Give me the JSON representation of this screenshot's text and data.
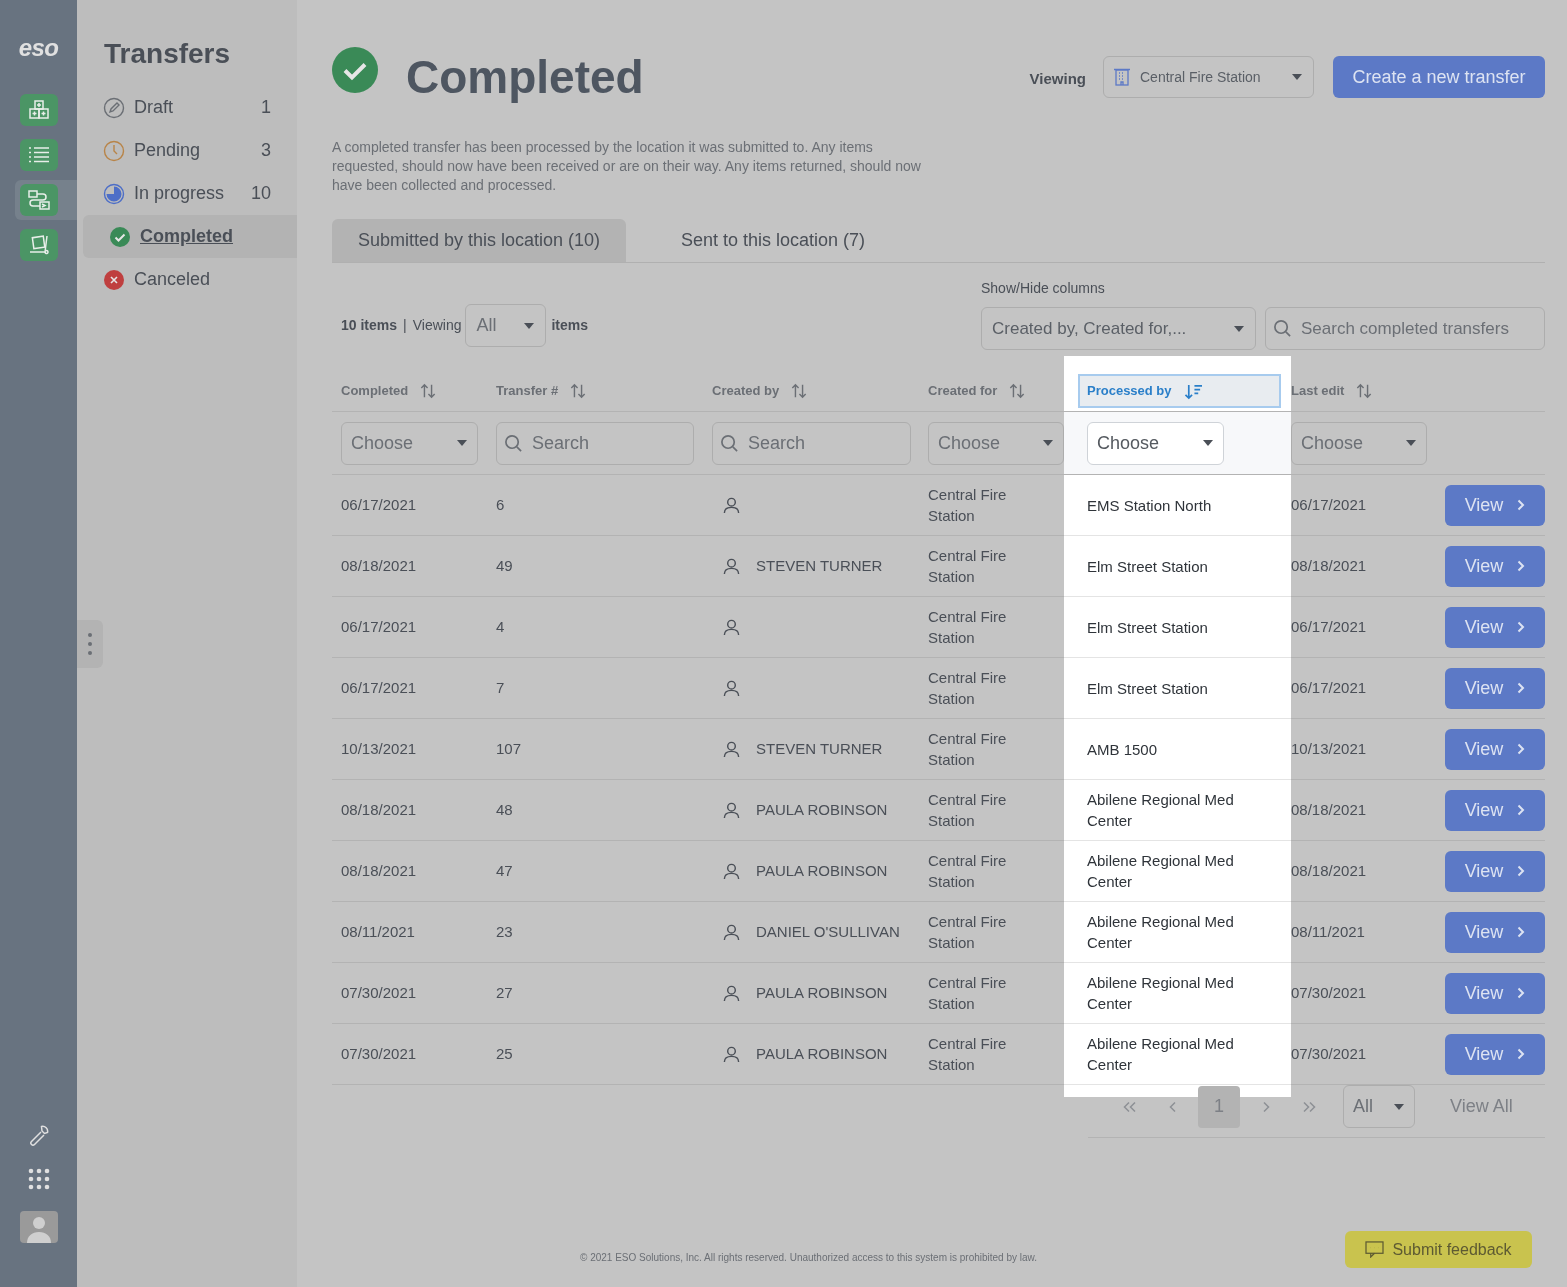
{
  "rail": {
    "logo": "eso",
    "items": [
      {
        "kind": "inventory",
        "selected": false
      },
      {
        "kind": "list",
        "selected": false
      },
      {
        "kind": "transfers",
        "selected": true
      },
      {
        "kind": "cart",
        "selected": false
      }
    ]
  },
  "sidebar": {
    "title": "Transfers",
    "items": [
      {
        "kind": "draft",
        "label": "Draft",
        "count": "1",
        "selected": false
      },
      {
        "kind": "pending",
        "label": "Pending",
        "count": "3",
        "selected": false
      },
      {
        "kind": "progress",
        "label": "In progress",
        "count": "10",
        "selected": false
      },
      {
        "kind": "completed",
        "label": "Completed",
        "selected": true
      },
      {
        "kind": "canceled",
        "label": "Canceled",
        "selected": false
      }
    ]
  },
  "header": {
    "title": "Completed",
    "viewing_label": "Viewing",
    "location": "Central Fire Station",
    "create_button": "Create a new transfer",
    "description": "A completed transfer has been processed by the location it was submitted to. Any items requested, should now have been received or are on their way. Any items returned, should now have been collected and processed."
  },
  "tabs": [
    {
      "label": "Submitted by this location (10)",
      "selected": true
    },
    {
      "label": "Sent to this location (7)",
      "selected": false
    }
  ],
  "toolbar": {
    "count": "10 items",
    "separator": "|",
    "viewing": "Viewing",
    "view_select": "All",
    "items_label": "items",
    "columns_label": "Show/Hide columns",
    "columns_select": "Created by, Created for,...",
    "search_placeholder": "Search completed transfers"
  },
  "table": {
    "columns": [
      {
        "label": "Completed",
        "sorted": false,
        "highlighted": false
      },
      {
        "label": "Transfer #",
        "sorted": false,
        "highlighted": false
      },
      {
        "label": "Created by",
        "sorted": false,
        "highlighted": false
      },
      {
        "label": "Created for",
        "sorted": false,
        "highlighted": false
      },
      {
        "label": "Processed by",
        "sorted": true,
        "highlighted": true
      },
      {
        "label": "Last edit",
        "sorted": false,
        "highlighted": false
      }
    ],
    "filters": [
      {
        "kind": "select",
        "placeholder": "Choose"
      },
      {
        "kind": "search",
        "placeholder": "Search"
      },
      {
        "kind": "search",
        "placeholder": "Search"
      },
      {
        "kind": "select",
        "placeholder": "Choose"
      },
      {
        "kind": "select",
        "placeholder": "Choose"
      },
      {
        "kind": "select",
        "placeholder": "Choose"
      }
    ],
    "rows": [
      {
        "completed": "06/17/2021",
        "transfer": "6",
        "created_for": "Central Fire Station",
        "processed_by": "EMS Station North",
        "last_edit": "06/17/2021",
        "action": "View"
      },
      {
        "completed": "08/18/2021",
        "transfer": "49",
        "created_by": "STEVEN TURNER",
        "created_for": "Central Fire Station",
        "processed_by": "Elm Street Station",
        "last_edit": "08/18/2021",
        "action": "View"
      },
      {
        "completed": "06/17/2021",
        "transfer": "4",
        "created_for": "Central Fire Station",
        "processed_by": "Elm Street Station",
        "last_edit": "06/17/2021",
        "action": "View"
      },
      {
        "completed": "06/17/2021",
        "transfer": "7",
        "created_for": "Central Fire Station",
        "processed_by": "Elm Street Station",
        "last_edit": "06/17/2021",
        "action": "View"
      },
      {
        "completed": "10/13/2021",
        "transfer": "107",
        "created_by": "STEVEN TURNER",
        "created_for": "Central Fire Station",
        "processed_by": "AMB 1500",
        "last_edit": "10/13/2021",
        "action": "View"
      },
      {
        "completed": "08/18/2021",
        "transfer": "48",
        "created_by": "PAULA ROBINSON",
        "created_for": "Central Fire Station",
        "processed_by": "Abilene Regional Med Center",
        "last_edit": "08/18/2021",
        "action": "View"
      },
      {
        "completed": "08/18/2021",
        "transfer": "47",
        "created_by": "PAULA ROBINSON",
        "created_for": "Central Fire Station",
        "processed_by": "Abilene Regional Med Center",
        "last_edit": "08/18/2021",
        "action": "View"
      },
      {
        "completed": "08/11/2021",
        "transfer": "23",
        "created_by": "DANIEL O'SULLIVAN",
        "created_for": "Central Fire Station",
        "processed_by": "Abilene Regional Med Center",
        "last_edit": "08/11/2021",
        "action": "View"
      },
      {
        "completed": "07/30/2021",
        "transfer": "27",
        "created_by": "PAULA ROBINSON",
        "created_for": "Central Fire Station",
        "processed_by": "Abilene Regional Med Center",
        "last_edit": "07/30/2021",
        "action": "View"
      },
      {
        "completed": "07/30/2021",
        "transfer": "25",
        "created_by": "PAULA ROBINSON",
        "created_for": "Central Fire Station",
        "processed_by": "Abilene Regional Med Center",
        "last_edit": "07/30/2021",
        "action": "View"
      }
    ]
  },
  "pagination": {
    "pages": [
      {
        "label": "1",
        "selected": true
      }
    ],
    "size_select": "All",
    "view_all": "View All"
  },
  "footer": {
    "copyright": "© 2021 ESO Solutions, Inc. All rights reserved. Unauthorized access to this system is prohibited by law.",
    "feedback_button": "Submit feedback"
  }
}
